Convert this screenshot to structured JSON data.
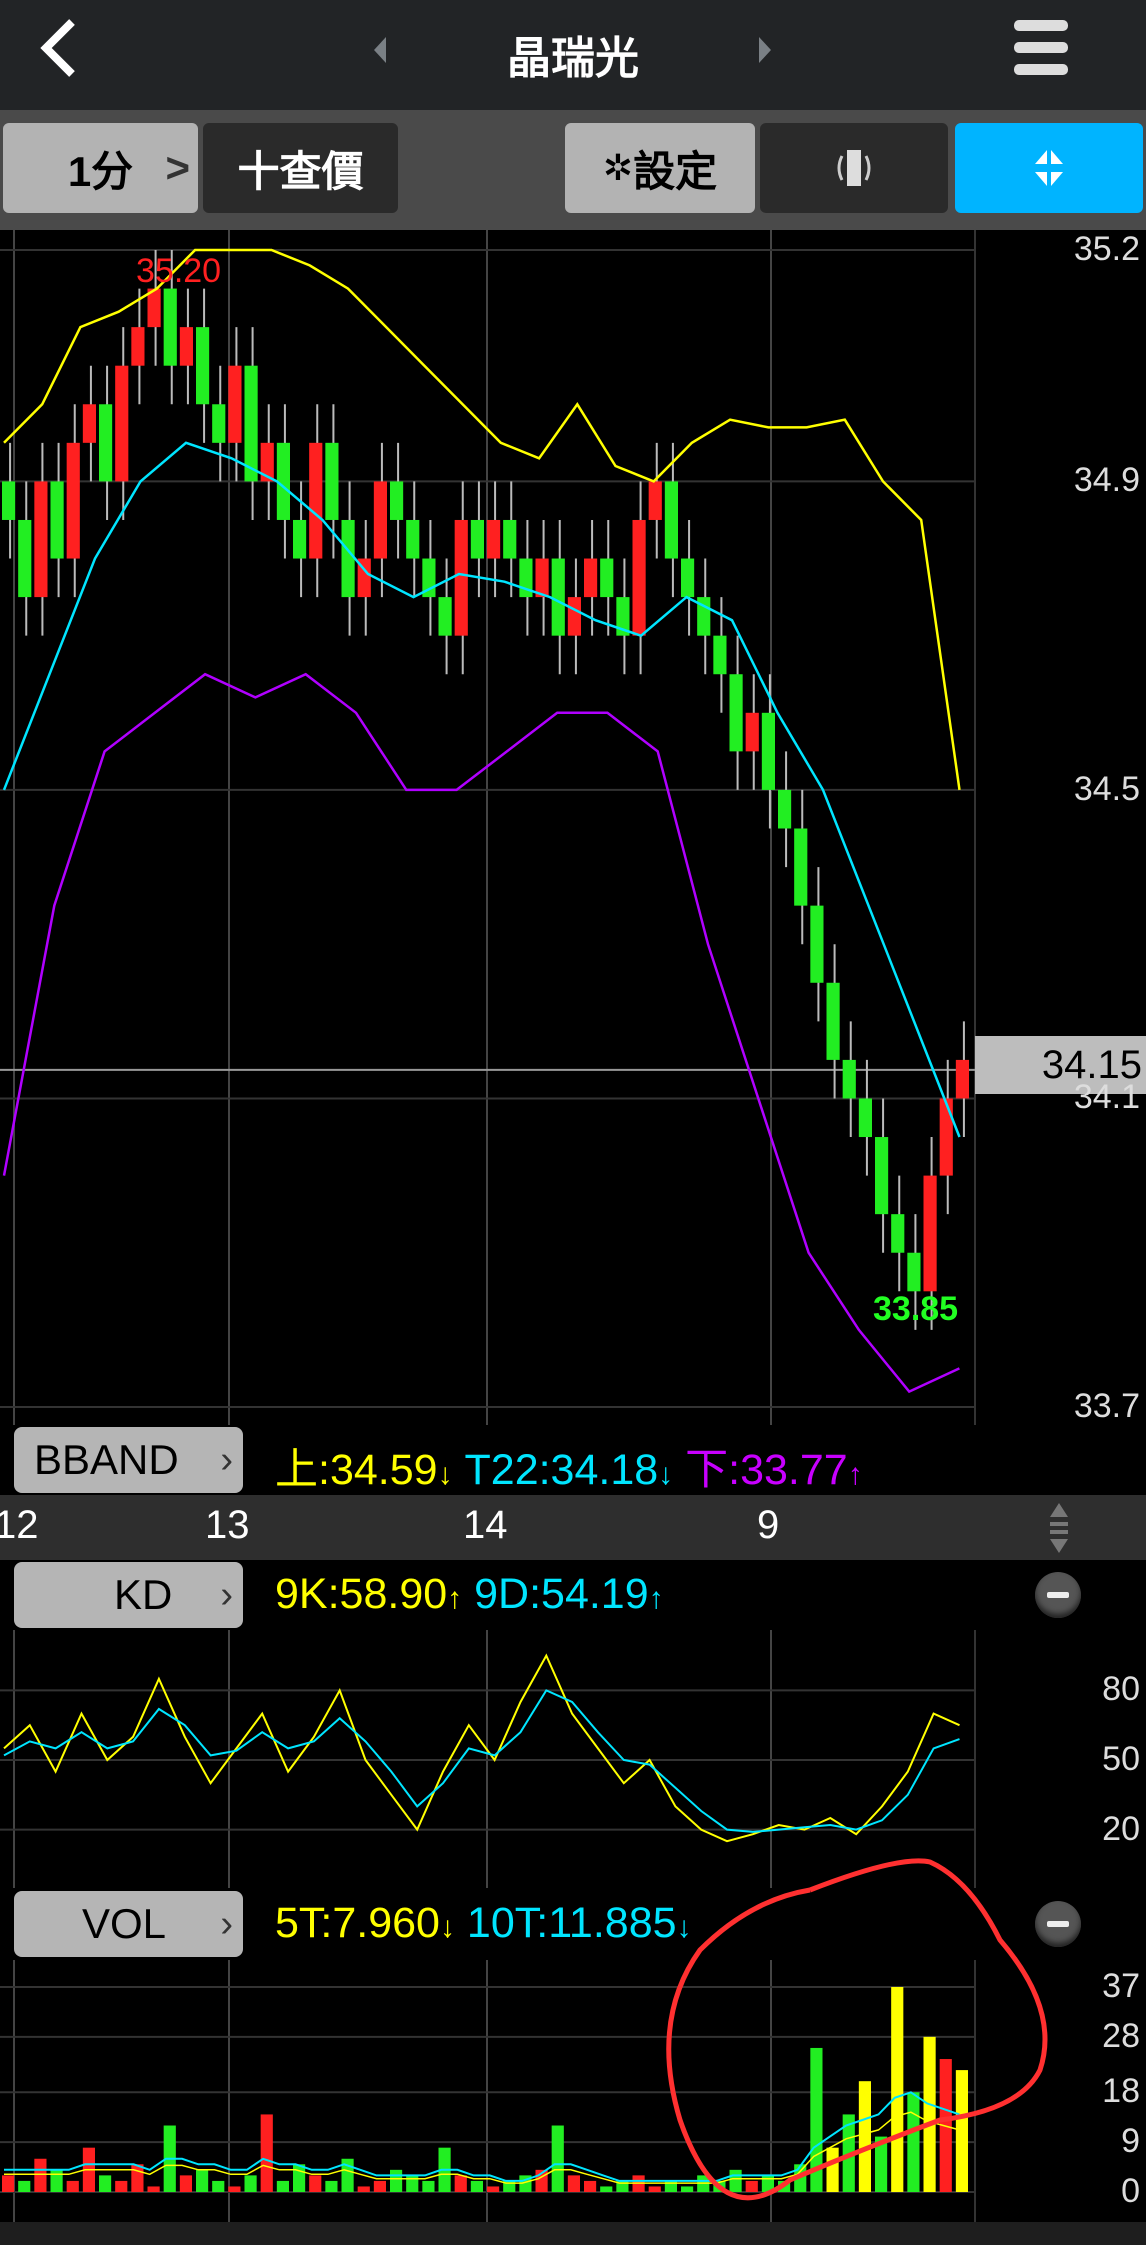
{
  "header": {
    "title": "晶瑞光",
    "back_icon": "chevron-left-icon",
    "prev_icon": "triangle-left-icon",
    "next_icon": "triangle-right-icon",
    "menu_icon": "hamburger-icon"
  },
  "toolbar": {
    "period": "1分",
    "period_chevron": ">",
    "quote": "十查價",
    "settings": "設定",
    "settings_icon": "gear-icon",
    "rotate_icon": "rotate-icon",
    "collapse_icon": "collapse-arrows-icon",
    "accent": "#00b4ff"
  },
  "main_chart": {
    "y_ticks": [
      "35.2",
      "34.9",
      "34.5",
      "34.1",
      "33.7"
    ],
    "current_price": "34.15",
    "high_label": "35.20",
    "low_label": "33.85",
    "bband": {
      "button": "BBAND",
      "upper": "上:34.59",
      "mid": "T22:34.18",
      "lower": "下:33.77"
    }
  },
  "x_axis": {
    "ticks": [
      "12",
      "13",
      "14",
      "9"
    ]
  },
  "kd": {
    "button": "KD",
    "k": "9K:58.90",
    "d": "9D:54.19",
    "y_ticks": [
      "80",
      "50",
      "20"
    ]
  },
  "vol": {
    "button": "VOL",
    "ma5": "5T:7.960",
    "ma10": "10T:11.885",
    "y_ticks": [
      "37",
      "28",
      "18",
      "9",
      "0"
    ]
  },
  "chart_data": {
    "type": "candlestick",
    "price_range": [
      33.7,
      35.2
    ],
    "closes": [
      34.85,
      34.75,
      34.9,
      34.8,
      34.95,
      35.0,
      34.9,
      35.05,
      35.1,
      35.15,
      35.05,
      35.1,
      35.0,
      34.95,
      35.05,
      34.9,
      34.95,
      34.85,
      34.8,
      34.95,
      34.85,
      34.75,
      34.8,
      34.9,
      34.85,
      34.8,
      34.75,
      34.7,
      34.85,
      34.8,
      34.85,
      34.8,
      34.75,
      34.8,
      34.7,
      34.75,
      34.8,
      34.75,
      34.7,
      34.85,
      34.9,
      34.8,
      34.75,
      34.7,
      34.65,
      34.55,
      34.6,
      34.5,
      34.45,
      34.35,
      34.25,
      34.15,
      34.1,
      34.05,
      33.95,
      33.9,
      33.85,
      34.0,
      34.1,
      34.15
    ],
    "bb_upper": [
      34.95,
      35.0,
      35.1,
      35.12,
      35.15,
      35.2,
      35.2,
      35.2,
      35.18,
      35.15,
      35.1,
      35.05,
      35.0,
      34.95,
      34.93,
      35.0,
      34.92,
      34.9,
      34.95,
      34.98,
      34.97,
      34.97,
      34.98,
      34.9,
      34.85,
      34.5
    ],
    "bb_mid": [
      34.5,
      34.65,
      34.8,
      34.9,
      34.95,
      34.93,
      34.9,
      34.85,
      34.78,
      34.75,
      34.78,
      34.77,
      34.75,
      34.72,
      34.7,
      34.75,
      34.72,
      34.6,
      34.5,
      34.35,
      34.2,
      34.05
    ],
    "bb_lower": [
      34.0,
      34.35,
      34.55,
      34.6,
      34.65,
      34.62,
      34.65,
      34.6,
      34.5,
      34.5,
      34.55,
      34.6,
      34.6,
      34.55,
      34.3,
      34.1,
      33.9,
      33.8,
      33.72,
      33.75
    ],
    "k": [
      55,
      65,
      45,
      70,
      50,
      60,
      85,
      60,
      40,
      55,
      70,
      45,
      60,
      80,
      50,
      35,
      20,
      45,
      65,
      50,
      75,
      95,
      70,
      55,
      40,
      50,
      30,
      20,
      15,
      18,
      22,
      20,
      25,
      18,
      30,
      45,
      70,
      65
    ],
    "d": [
      52,
      58,
      55,
      62,
      55,
      58,
      72,
      65,
      52,
      54,
      62,
      55,
      58,
      68,
      58,
      45,
      30,
      40,
      55,
      52,
      62,
      80,
      75,
      62,
      50,
      48,
      38,
      28,
      20,
      19,
      20,
      21,
      22,
      20,
      24,
      35,
      55,
      59
    ],
    "volume": [
      3,
      2,
      6,
      4,
      2,
      8,
      3,
      2,
      5,
      1,
      12,
      3,
      4,
      2,
      1,
      3,
      14,
      2,
      5,
      3,
      2,
      6,
      1,
      2,
      4,
      3,
      2,
      8,
      3,
      2,
      1,
      2,
      3,
      4,
      12,
      3,
      2,
      1,
      2,
      3,
      1,
      2,
      1,
      3,
      2,
      4,
      2,
      3,
      2,
      5,
      26,
      8,
      14,
      20,
      10,
      37,
      18,
      28,
      24,
      22
    ],
    "vol_ma": [
      4,
      4,
      4,
      4,
      4,
      5,
      5,
      5,
      5,
      4,
      6,
      6,
      5,
      5,
      4,
      4,
      6,
      5,
      5,
      4,
      4,
      5,
      4,
      3,
      3,
      3,
      3,
      4,
      4,
      3,
      3,
      2,
      2,
      3,
      5,
      5,
      4,
      3,
      2,
      2,
      2,
      2,
      2,
      2,
      2,
      3,
      3,
      3,
      3,
      4,
      8,
      10,
      12,
      13,
      14,
      17,
      18,
      16,
      15,
      14
    ]
  }
}
